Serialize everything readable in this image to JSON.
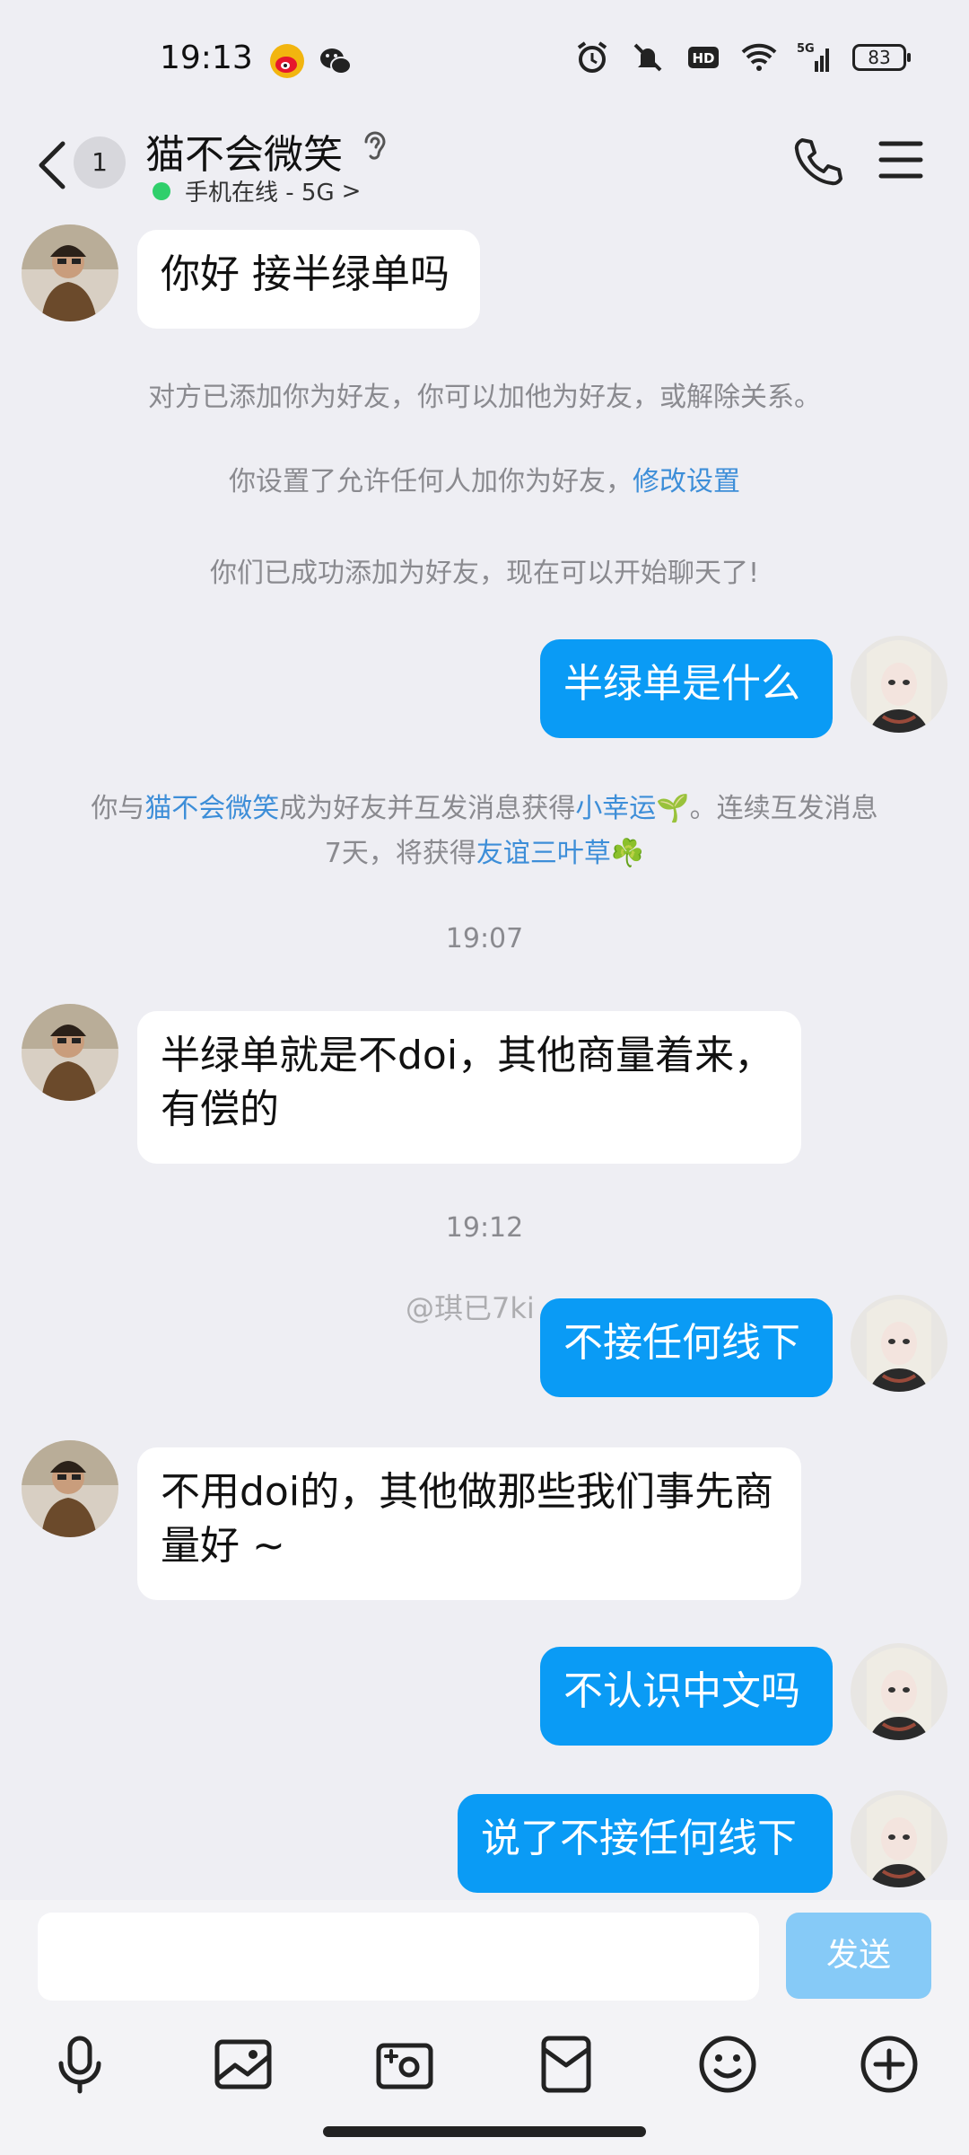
{
  "status_bar": {
    "time": "19:13",
    "apps": [
      "weibo-icon",
      "wechat-icon"
    ],
    "icons": [
      "alarm-icon",
      "mute-icon",
      "hd-icon",
      "wifi-icon",
      "signal-5g-icon"
    ],
    "battery": "83"
  },
  "header": {
    "unread_count": "1",
    "title": "猫不会微笑",
    "status": "手机在线 - 5G",
    "status_chevron": ">"
  },
  "messages": {
    "m1": "你好 接半绿单吗",
    "sys1": "对方已添加你为好友，你可以加他为好友，或解除关系。",
    "sys2_text": "你设置了允许任何人加你为好友，",
    "sys2_link": "修改设置",
    "sys3": "你们已成功添加为好友，现在可以开始聊天了!",
    "m2": "半绿单是什么",
    "sys4_a": "你与",
    "sys4_link1": "猫不会微笑",
    "sys4_b": "成为好友并互发消息获得",
    "sys4_link2": "小幸运🌱",
    "sys4_c": "。连续互发消息",
    "sys4_d": "7天，将获得",
    "sys4_link3": "友谊三叶草☘️",
    "time1": "19:07",
    "m3": "半绿单就是不doi，其他商量着来，有偿的",
    "time2": "19:12",
    "m4": "不接任何线下",
    "m5": "不用doi的，其他做那些我们事先商量好 ~",
    "m6": "不认识中文吗",
    "m7": "说了不接任何线下",
    "watermark": "@琪已7ki"
  },
  "input": {
    "placeholder": "",
    "send_label": "发送"
  },
  "toolbar": [
    "mic-icon",
    "image-icon",
    "camera-icon",
    "red-packet-icon",
    "emoji-icon",
    "plus-icon"
  ],
  "colors": {
    "background": "#eeeef3",
    "outgoing_bubble": "#0a9bf5",
    "incoming_bubble": "#ffffff",
    "link": "#3d8ed8",
    "online_dot": "#2fcf6b",
    "send_disabled": "#86caf7"
  }
}
